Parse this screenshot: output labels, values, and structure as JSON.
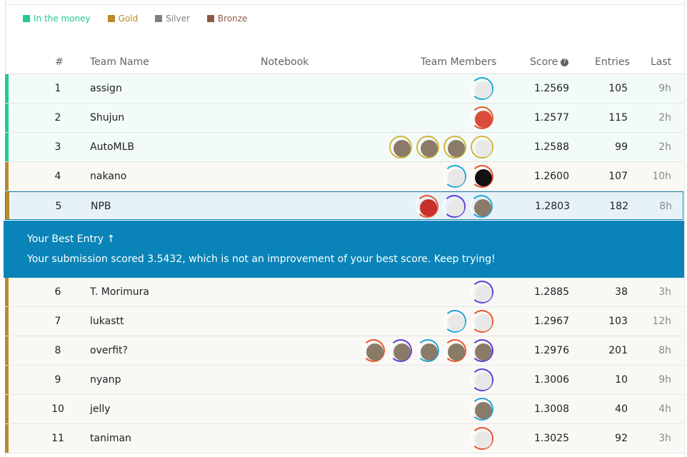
{
  "legend": [
    {
      "label": "In the money",
      "color": "#20c997"
    },
    {
      "label": "Gold",
      "color": "#b88a2a"
    },
    {
      "label": "Silver",
      "color": "#7f7f7f"
    },
    {
      "label": "Bronze",
      "color": "#8b5a44"
    }
  ],
  "headers": {
    "rank": "#",
    "team": "Team Name",
    "notebook": "Notebook",
    "members": "Team Members",
    "score": "Score",
    "entries": "Entries",
    "last": "Last"
  },
  "rows": [
    {
      "rank": "1",
      "team": "assign",
      "score": "1.2569",
      "entries": "105",
      "last": "9h",
      "tier": "money",
      "members": [
        "light"
      ]
    },
    {
      "rank": "2",
      "team": "Shujun",
      "score": "1.2577",
      "entries": "115",
      "last": "2h",
      "tier": "money",
      "members": [
        "flag"
      ]
    },
    {
      "rank": "3",
      "team": "AutoMLB",
      "score": "1.2588",
      "entries": "99",
      "last": "2h",
      "tier": "money",
      "members": [
        "photo",
        "photo",
        "photo",
        "light"
      ]
    },
    {
      "rank": "4",
      "team": "nakano",
      "score": "1.2600",
      "entries": "107",
      "last": "10h",
      "tier": "gold",
      "members": [
        "light",
        "dark"
      ]
    },
    {
      "rank": "5",
      "team": "NPB",
      "score": "1.2803",
      "entries": "182",
      "last": "8h",
      "tier": "gold",
      "members": [
        "red",
        "light",
        "photo"
      ]
    },
    {
      "rank": "6",
      "team": "T. Morimura",
      "score": "1.2885",
      "entries": "38",
      "last": "3h",
      "tier": "gold",
      "members": [
        "light"
      ]
    },
    {
      "rank": "7",
      "team": "lukastt",
      "score": "1.2967",
      "entries": "103",
      "last": "12h",
      "tier": "gold",
      "members": [
        "light",
        "light"
      ]
    },
    {
      "rank": "8",
      "team": "overfit?",
      "score": "1.2976",
      "entries": "201",
      "last": "8h",
      "tier": "gold",
      "members": [
        "photo",
        "photo",
        "photo",
        "photo",
        "photo"
      ]
    },
    {
      "rank": "9",
      "team": "nyanp",
      "score": "1.3006",
      "entries": "10",
      "last": "9h",
      "tier": "gold",
      "members": [
        "light"
      ]
    },
    {
      "rank": "10",
      "team": "jelly",
      "score": "1.3008",
      "entries": "40",
      "last": "4h",
      "tier": "gold",
      "members": [
        "photo"
      ]
    },
    {
      "rank": "11",
      "team": "taniman",
      "score": "1.3025",
      "entries": "92",
      "last": "3h",
      "tier": "gold",
      "members": [
        "light"
      ]
    }
  ],
  "banner": {
    "title": "Your Best Entry ↑",
    "message": "Your submission scored 3.5432, which is not an improvement of your best score. Keep trying!"
  }
}
